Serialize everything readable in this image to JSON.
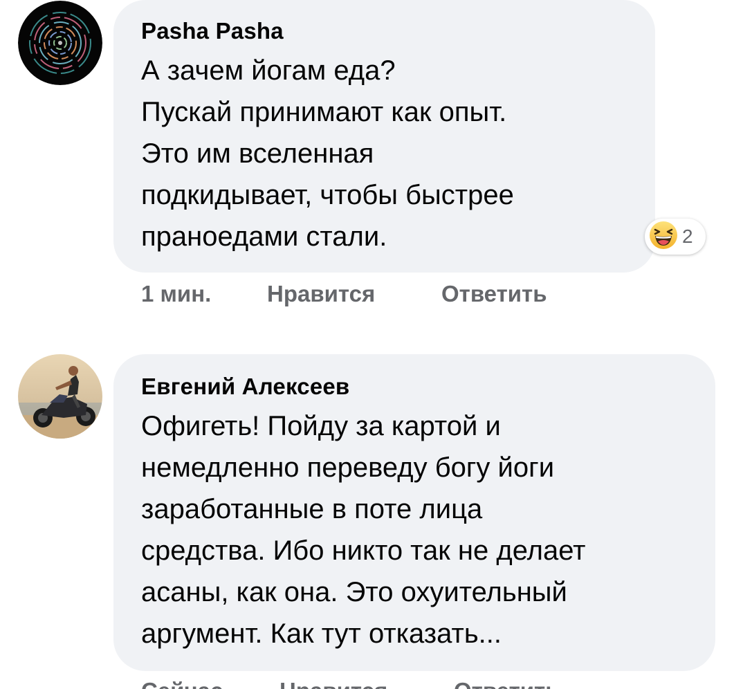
{
  "comments": [
    {
      "author": "Pasha Pasha",
      "lines": [
        "А зачем йогам еда?",
        "Пускай принимают как опыт.",
        "Это им вселенная",
        "подкидывает, чтобы быстрее",
        "праноедами стали."
      ],
      "reaction": {
        "icon": "laughing-emoji-icon",
        "count": "2"
      },
      "actions": {
        "time": "1 мин.",
        "like": "Нравится",
        "reply": "Ответить"
      }
    },
    {
      "author": "Евгений Алексеев",
      "lines": [
        "Офигеть! Пойду за картой и",
        "немедленно переведу богу йоги",
        "заработанные в поте лица",
        "средства. Ибо никто так не делает",
        "асаны, как она. Это охуительный",
        "аргумент. Как тут отказать..."
      ],
      "actions": {
        "time": "Сейчас",
        "like": "Нравится",
        "reply": "Ответить"
      }
    }
  ]
}
